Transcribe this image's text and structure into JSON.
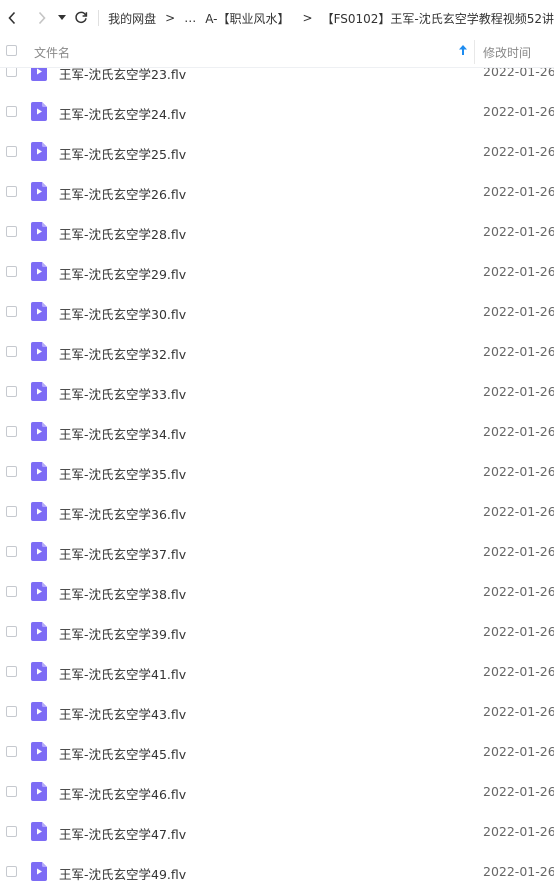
{
  "toolbar": {
    "back_icon": "chevron-left-icon",
    "forward_icon": "chevron-right-icon",
    "history_icon": "caret-down-icon",
    "refresh_icon": "refresh-icon",
    "breadcrumbs": [
      "我的网盘",
      "…",
      "A-【职业风水】",
      "【FS0102】王军-沈氏玄空学教程视频52讲"
    ],
    "separator": ">"
  },
  "header": {
    "name_label": "文件名",
    "time_label": "修改时间",
    "sort_icon": "sort-arrow-up-icon",
    "accent_color": "#1e8cf0"
  },
  "file_icon": {
    "name": "video-file-icon",
    "color": "#7d6cf5"
  },
  "files": [
    {
      "name": "王军-沈氏玄空学23.flv",
      "date": "2022-01-26"
    },
    {
      "name": "王军-沈氏玄空学24.flv",
      "date": "2022-01-26"
    },
    {
      "name": "王军-沈氏玄空学25.flv",
      "date": "2022-01-26"
    },
    {
      "name": "王军-沈氏玄空学26.flv",
      "date": "2022-01-26"
    },
    {
      "name": "王军-沈氏玄空学28.flv",
      "date": "2022-01-26"
    },
    {
      "name": "王军-沈氏玄空学29.flv",
      "date": "2022-01-26"
    },
    {
      "name": "王军-沈氏玄空学30.flv",
      "date": "2022-01-26"
    },
    {
      "name": "王军-沈氏玄空学32.flv",
      "date": "2022-01-26"
    },
    {
      "name": "王军-沈氏玄空学33.flv",
      "date": "2022-01-26"
    },
    {
      "name": "王军-沈氏玄空学34.flv",
      "date": "2022-01-26"
    },
    {
      "name": "王军-沈氏玄空学35.flv",
      "date": "2022-01-26"
    },
    {
      "name": "王军-沈氏玄空学36.flv",
      "date": "2022-01-26"
    },
    {
      "name": "王军-沈氏玄空学37.flv",
      "date": "2022-01-26"
    },
    {
      "name": "王军-沈氏玄空学38.flv",
      "date": "2022-01-26"
    },
    {
      "name": "王军-沈氏玄空学39.flv",
      "date": "2022-01-26"
    },
    {
      "name": "王军-沈氏玄空学41.flv",
      "date": "2022-01-26"
    },
    {
      "name": "王军-沈氏玄空学43.flv",
      "date": "2022-01-26"
    },
    {
      "name": "王军-沈氏玄空学45.flv",
      "date": "2022-01-26"
    },
    {
      "name": "王军-沈氏玄空学46.flv",
      "date": "2022-01-26"
    },
    {
      "name": "王军-沈氏玄空学47.flv",
      "date": "2022-01-26"
    },
    {
      "name": "王军-沈氏玄空学49.flv",
      "date": "2022-01-26"
    }
  ]
}
